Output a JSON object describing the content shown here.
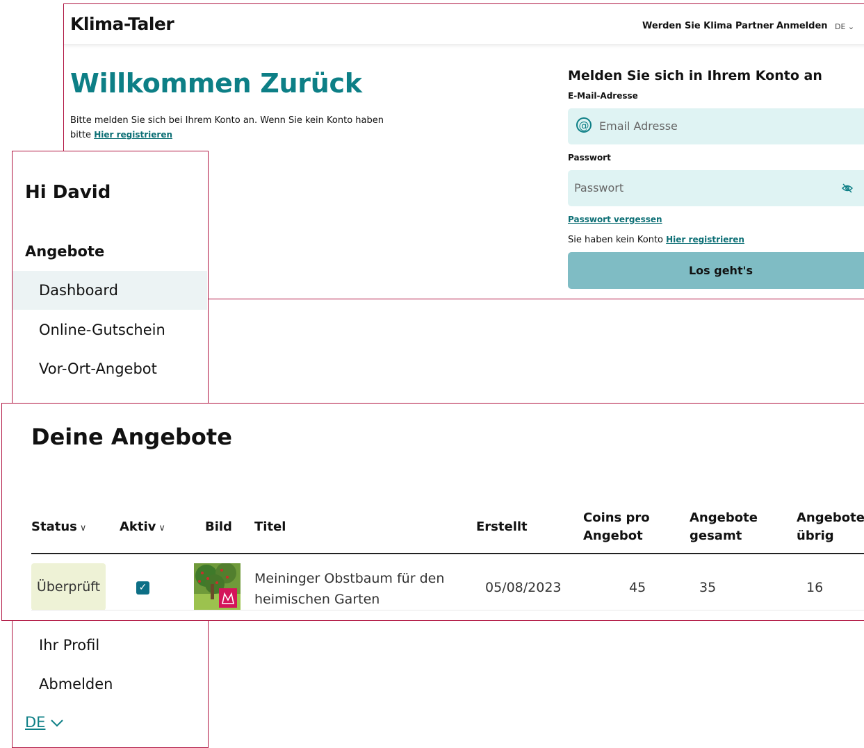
{
  "login": {
    "brand": "Klima-Taler",
    "nav_partner": "Werden Sie Klima Partner",
    "nav_login": "Anmelden",
    "nav_lang": "DE",
    "welcome_title": "Willkommen Zurück",
    "welcome_text": "Bitte melden Sie sich bei Ihrem Konto an. Wenn Sie kein Konto haben bitte",
    "welcome_register_link": "Hier registrieren",
    "form_title": "Melden Sie sich in Ihrem Konto an",
    "email_label": "E-Mail-Adresse",
    "email_placeholder": "Email Adresse",
    "password_label": "Passwort",
    "password_placeholder": "Passwort",
    "forgot_link": "Passwort vergessen",
    "no_account_text": "Sie haben kein Konto",
    "no_account_link": "Hier registrieren",
    "submit_label": "Los geht's"
  },
  "sidebar": {
    "greeting": "Hi David",
    "section": "Angebote",
    "items": [
      {
        "label": "Dashboard",
        "active": true
      },
      {
        "label": "Online-Gutschein"
      },
      {
        "label": "Vor-Ort-Angebot"
      },
      {
        "label": "Ihr Profil"
      },
      {
        "label": "Abmelden"
      }
    ],
    "lang": "DE"
  },
  "offers": {
    "title": "Deine Angebote",
    "columns": {
      "status": "Status",
      "aktiv": "Aktiv",
      "bild": "Bild",
      "titel": "Titel",
      "erstellt": "Erstellt",
      "coins_line1": "Coins pro",
      "coins_line2": "Angebot",
      "gesamt_line1": "Angebote",
      "gesamt_line2": "gesamt",
      "uebrig_line1": "Angebote",
      "uebrig_line2": "übrig"
    },
    "rows": [
      {
        "status": "Überprüft",
        "aktiv": true,
        "title_line1": "Meininger Obstbaum für den",
        "title_line2": "heimischen Garten",
        "erstellt": "05/08/2023",
        "coins": "45",
        "gesamt": "35",
        "uebrig": "16"
      }
    ]
  },
  "colors": {
    "accent": "#0d7f86",
    "outline": "#b0123f",
    "field_bg": "#dff3f3",
    "button_bg": "#7fbcc4",
    "status_badge_bg": "#eef2d6"
  }
}
